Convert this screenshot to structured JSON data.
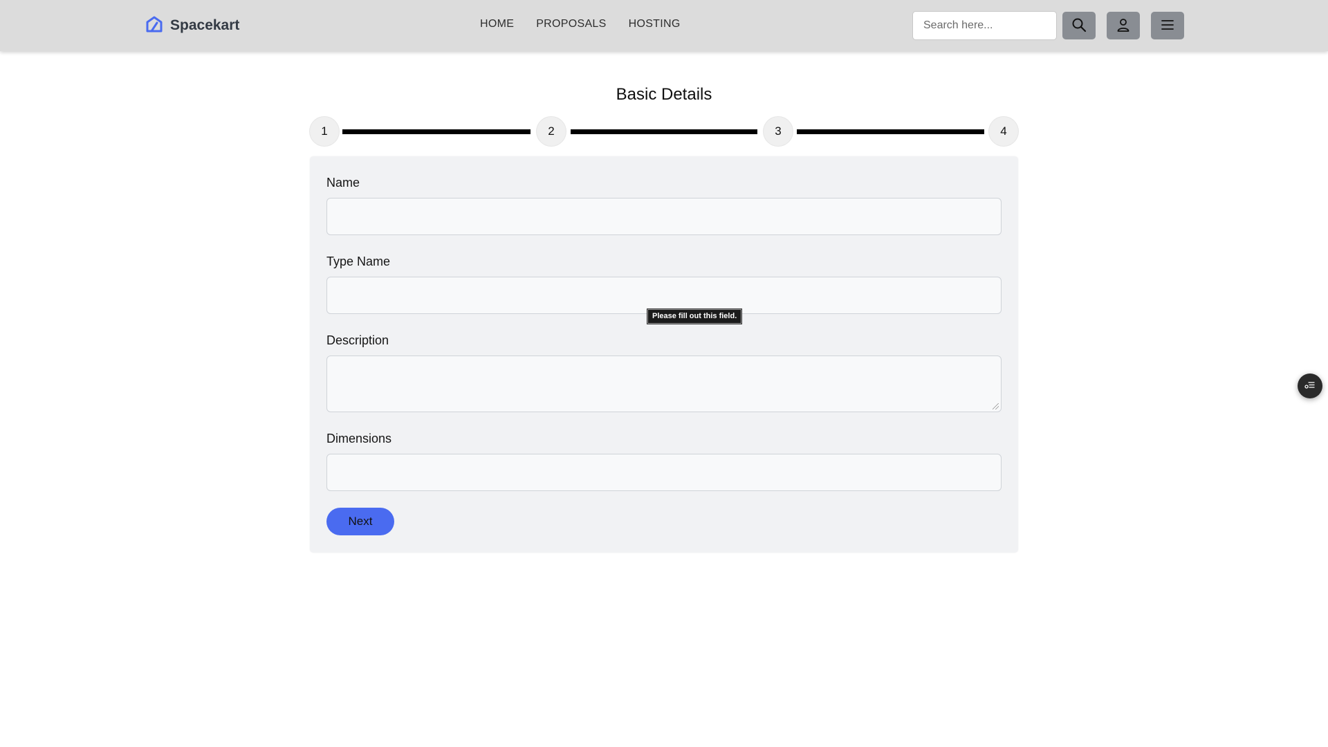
{
  "brand": {
    "name": "Spacekart",
    "logo_icon": "house-logo-icon",
    "logo_color": "#4a6bf0"
  },
  "nav": {
    "links": [
      {
        "label": "HOME"
      },
      {
        "label": "PROPOSALS"
      },
      {
        "label": "HOSTING"
      }
    ]
  },
  "search": {
    "placeholder": "Search here...",
    "value": ""
  },
  "header_buttons": {
    "search_icon": "search-icon",
    "user_icon": "user-icon",
    "menu_icon": "hamburger-menu-icon",
    "background": "#898d93"
  },
  "page": {
    "title": "Basic Details"
  },
  "stepper": {
    "steps": [
      "1",
      "2",
      "3",
      "4"
    ],
    "current": 1
  },
  "form": {
    "fields": [
      {
        "label": "Name",
        "value": ""
      },
      {
        "label": "Type Name",
        "value": ""
      },
      {
        "label": "Description",
        "value": ""
      },
      {
        "label": "Dimensions",
        "value": ""
      }
    ],
    "next_label": "Next",
    "next_color": "#4a6bf0"
  },
  "tooltip": {
    "text": "Please fill out this field."
  },
  "floating_button": {
    "icon": "checklist-icon"
  }
}
